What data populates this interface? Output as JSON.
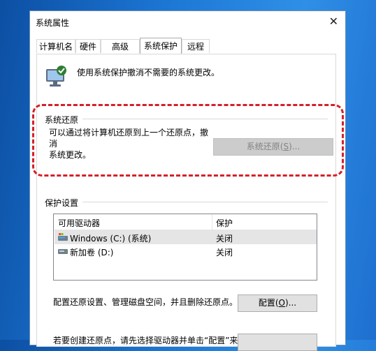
{
  "window": {
    "title": "系统属性",
    "close_glyph": "✕"
  },
  "tabs": [
    {
      "label": "计算机名",
      "active": false
    },
    {
      "label": "硬件",
      "active": false
    },
    {
      "label": "高级",
      "active": false
    },
    {
      "label": "系统保护",
      "active": true
    },
    {
      "label": "远程",
      "active": false
    }
  ],
  "intro": {
    "text": "使用系统保护撤消不需要的系统更改。",
    "icon": "computer-shield-icon"
  },
  "restore": {
    "group_title": "系统还原",
    "desc_line1": "可以通过将计算机还原到上一个还原点，撤消",
    "desc_line2": "系统更改。",
    "button_prefix": "系统还原(",
    "button_key": "S",
    "button_suffix": ")..."
  },
  "protection": {
    "group_title": "保护设置",
    "col_drives": "可用驱动器",
    "col_protection": "保护",
    "rows": [
      {
        "name": "Windows (C:) (系统)",
        "protection": "关闭",
        "icon": "system-drive-icon"
      },
      {
        "name": "新加卷 (D:)",
        "protection": "关闭",
        "icon": "drive-icon"
      }
    ]
  },
  "configure": {
    "desc": "配置还原设置、管理磁盘空间，并且删除还原点。",
    "button_prefix": "配置(",
    "button_key": "O",
    "button_suffix": ")..."
  },
  "create": {
    "desc": "若要创建还原点，请先选择驱动器并单击“配置”来"
  },
  "colors": {
    "highlight_border": "#d4202a",
    "accent": "#1d78d6"
  }
}
